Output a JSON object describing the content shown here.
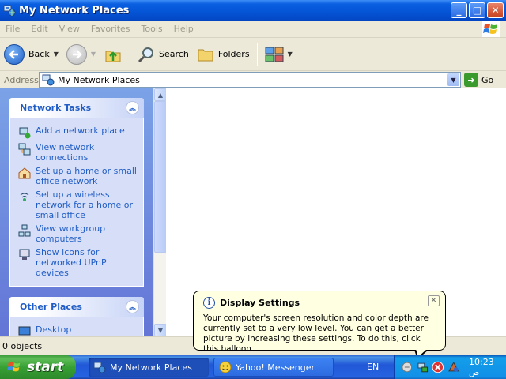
{
  "window": {
    "title": "My Network Places",
    "controls": {
      "minimize": "_",
      "maximize": "□",
      "close": "✕"
    }
  },
  "menubar": {
    "items": [
      "File",
      "Edit",
      "View",
      "Favorites",
      "Tools",
      "Help"
    ]
  },
  "toolbar": {
    "back_label": "Back",
    "search_label": "Search",
    "folders_label": "Folders"
  },
  "address": {
    "label": "Address",
    "value": "My Network Places",
    "go_label": "Go"
  },
  "network_tasks": {
    "title": "Network Tasks",
    "items": [
      {
        "label": "Add a network place",
        "icon": "add-network-place-icon"
      },
      {
        "label": "View network connections",
        "icon": "network-connections-icon"
      },
      {
        "label": "Set up a home or small office network",
        "icon": "home-network-icon"
      },
      {
        "label": "Set up a wireless network for a home or small office",
        "icon": "wireless-network-icon"
      },
      {
        "label": "View workgroup computers",
        "icon": "workgroup-icon"
      },
      {
        "label": "Show icons for networked UPnP devices",
        "icon": "upnp-icon"
      }
    ]
  },
  "other_places": {
    "title": "Other Places",
    "items": [
      {
        "label": "Desktop",
        "icon": "desktop-icon"
      }
    ]
  },
  "statusbar": {
    "text": "0 objects"
  },
  "balloon": {
    "title": "Display Settings",
    "body": "Your computer's screen resolution and color depth are currently set to a very low level. You can get a better picture by increasing these settings. To do this, click this balloon."
  },
  "taskbar": {
    "start_label": "start",
    "tasks": [
      {
        "label": "My Network Places",
        "active": true
      },
      {
        "label": "Yahoo! Messenger",
        "active": false
      }
    ],
    "language": "EN",
    "clock": "10:23 ص"
  },
  "colors": {
    "title_blue": "#0554d6",
    "link_blue": "#215dc6",
    "start_green": "#37a034",
    "balloon_bg": "#ffffe1"
  }
}
